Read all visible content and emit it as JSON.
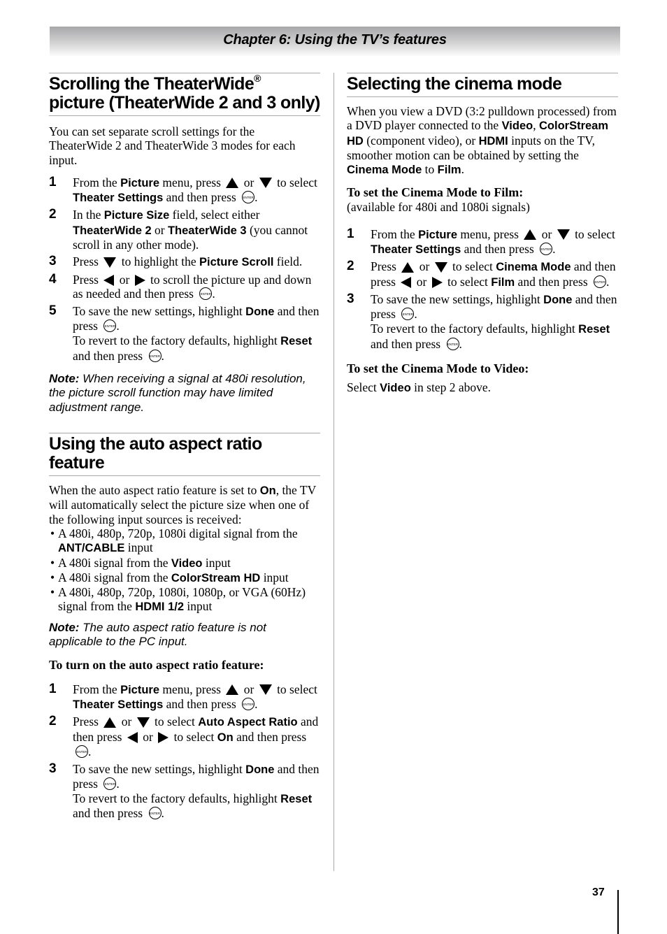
{
  "header": {
    "chapter_title": "Chapter 6: Using the TV’s features"
  },
  "icons": {
    "enter": "ENTER",
    "up": "up-arrow-icon",
    "down": "down-arrow-icon",
    "left": "left-arrow-icon",
    "right": "right-arrow-icon"
  },
  "scroll_section": {
    "title_part1": "Scrolling the TheaterWide",
    "title_reg": "®",
    "title_part2": " picture (TheaterWide 2 and 3 only)",
    "intro": "You can set separate scroll settings for the TheaterWide 2 and TheaterWide 3 modes for each input.",
    "steps": [
      {
        "num": "1",
        "t1": "From the ",
        "b1": "Picture",
        "t2": " menu, press ",
        "t3": " or ",
        "t4": " to select ",
        "b2": "Theater Settings",
        "t5": " and then press ",
        "t6": "."
      },
      {
        "num": "2",
        "t1": "In the ",
        "b1": "Picture Size",
        "t2": " field, select either ",
        "b2": "TheaterWide 2",
        "t3": " or ",
        "b3": "TheaterWide 3",
        "t4": " (you cannot scroll in any other mode)."
      },
      {
        "num": "3",
        "t1": "Press ",
        "t2": " to highlight the ",
        "b1": "Picture Scroll",
        "t3": " field."
      },
      {
        "num": "4",
        "t1": "Press ",
        "t2": " or ",
        "t3": " to scroll the picture up and down as needed and then press ",
        "t4": "."
      },
      {
        "num": "5",
        "t1": "To save the new settings, highlight ",
        "b1": "Done",
        "t2": " and then press ",
        "t3": ".",
        "t4": "To revert to the factory defaults, highlight ",
        "b2": "Reset",
        "t5": " and then press ",
        "t6": "."
      }
    ],
    "note_label": "Note:",
    "note_text": " When receiving a signal at 480i resolution, the picture scroll function may have limited adjustment range."
  },
  "auto_aspect_section": {
    "title": "Using the auto aspect ratio feature",
    "intro_t1": "When the auto aspect ratio feature is set to ",
    "intro_b1": "On",
    "intro_t2": ", the TV will automatically select the picture size when one of the following input sources is received:",
    "bullets": [
      {
        "text": "A 480i, 480p, 720p, 1080i digital signal from the ",
        "bold": "ANT/CABLE",
        "after": " input"
      },
      {
        "text": "A 480i signal from the ",
        "bold": "Video",
        "after": " input"
      },
      {
        "text": "A 480i signal from the ",
        "bold": "ColorStream HD",
        "after": " input"
      },
      {
        "text": "A 480i, 480p, 720p, 1080i, 1080p, or VGA (60Hz) signal from the ",
        "bold": "HDMI 1/2",
        "after": " input"
      }
    ],
    "note_label": "Note:",
    "note_text": " The auto aspect ratio feature is not applicable to the PC input.",
    "subhead": "To turn on the auto aspect ratio feature:",
    "steps": [
      {
        "num": "1",
        "t1": "From the ",
        "b1": "Picture",
        "t2": " menu, press ",
        "t3": " or ",
        "t4": " to select ",
        "b2": "Theater Settings",
        "t5": " and then press ",
        "t6": "."
      },
      {
        "num": "2",
        "t1": "Press ",
        "t2": " or ",
        "t3": " to select ",
        "b1": "Auto Aspect Ratio",
        "t4": " and then press ",
        "t5": " or ",
        "t6": " to select ",
        "b2": "On",
        "t7": " and then press ",
        "t8": "."
      },
      {
        "num": "3",
        "t1": "To save the new settings, highlight ",
        "b1": "Done",
        "t2": " and then press ",
        "t3": ".",
        "t4": "To revert to the factory defaults, highlight ",
        "b2": "Reset",
        "t5": " and then press ",
        "t6": "."
      }
    ]
  },
  "cinema_section": {
    "title": "Selecting the cinema mode",
    "intro": {
      "t1": "When you view a DVD (3:2 pulldown processed) from a DVD player connected to the ",
      "b1": "Video",
      "t2": ", ",
      "b2": "ColorStream HD",
      "t3": " (component video), or ",
      "b3": "HDMI",
      "t4": " inputs on the TV, smoother motion can be obtained by setting the ",
      "b4": "Cinema Mode",
      "t5": " to ",
      "b5": "Film",
      "t6": "."
    },
    "film_subhead": "To set the Cinema Mode to Film:",
    "film_note": "(available for 480i and 1080i signals)",
    "steps": [
      {
        "num": "1",
        "t1": "From the ",
        "b1": "Picture",
        "t2": " menu, press ",
        "t3": " or ",
        "t4": " to select ",
        "b2": "Theater Settings",
        "t5": " and then press ",
        "t6": "."
      },
      {
        "num": "2",
        "t1": "Press ",
        "t2": " or ",
        "t3": " to select ",
        "b1": "Cinema Mode",
        "t4": " and then press ",
        "t5": " or ",
        "t6": " to select ",
        "b2": "Film",
        "t7": " and then press ",
        "t8": "."
      },
      {
        "num": "3",
        "t1": "To save the new settings, highlight ",
        "b1": "Done",
        "t2": " and then press ",
        "t3": ".",
        "t4": "To revert to the factory defaults, highlight ",
        "b2": "Reset",
        "t5": " and then press ",
        "t6": "."
      }
    ],
    "video_subhead": "To set the Cinema Mode to Video:",
    "video_t1": "Select ",
    "video_b1": "Video",
    "video_t2": " in step 2 above."
  },
  "footer": {
    "page_number": "37"
  }
}
